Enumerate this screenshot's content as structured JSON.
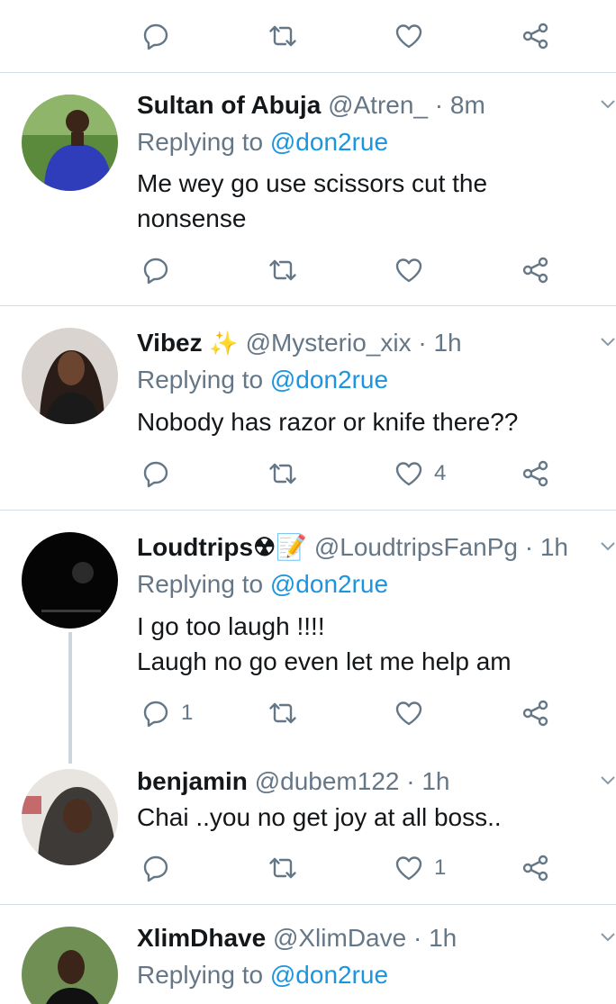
{
  "colors": {
    "accent": "#1b95e0",
    "muted": "#657786",
    "text": "#14171a",
    "divider": "#d6dde3"
  },
  "icons": {
    "reply": "reply-icon",
    "retweet": "retweet-icon",
    "like": "like-icon",
    "share": "share-icon",
    "menu": "chevron-down-icon"
  },
  "top_actions": {
    "reply_count": "",
    "retweet_count": "",
    "like_count": ""
  },
  "tweets": [
    {
      "name": "Sultan of Abuja",
      "emoji": "",
      "handle": "@Atren_",
      "sep": "·",
      "time": "8m",
      "replying_label": "Replying to",
      "replying_to": "@don2rue",
      "text": "Me wey go use scissors cut the nonsense",
      "reply_count": "",
      "retweet_count": "",
      "like_count": ""
    },
    {
      "name": "Vibez",
      "emoji": "✨",
      "handle": "@Mysterio_xix",
      "sep": "·",
      "time": "1h",
      "replying_label": "Replying to",
      "replying_to": "@don2rue",
      "text": "Nobody has razor or knife there??",
      "reply_count": "",
      "retweet_count": "",
      "like_count": "4"
    },
    {
      "name": "Loudtrips☢📝",
      "emoji": "",
      "handle": "@LoudtripsFanPg",
      "sep": "·",
      "time": "1h",
      "replying_label": "Replying to",
      "replying_to": "@don2rue",
      "text": "I go too laugh !!!!\nLaugh no go even let me help am",
      "reply_count": "1",
      "retweet_count": "",
      "like_count": ""
    },
    {
      "name": "benjamin",
      "emoji": "",
      "handle": "@dubem122",
      "sep": "·",
      "time": "1h",
      "replying_label": "",
      "replying_to": "",
      "text": "Chai ..you no get joy at all boss..",
      "reply_count": "",
      "retweet_count": "",
      "like_count": "1"
    },
    {
      "name": "XlimDhave",
      "emoji": "",
      "handle": "@XlimDave",
      "sep": "·",
      "time": "1h",
      "replying_label": "Replying to",
      "replying_to": "@don2rue",
      "text": "",
      "reply_count": "",
      "retweet_count": "",
      "like_count": ""
    }
  ]
}
